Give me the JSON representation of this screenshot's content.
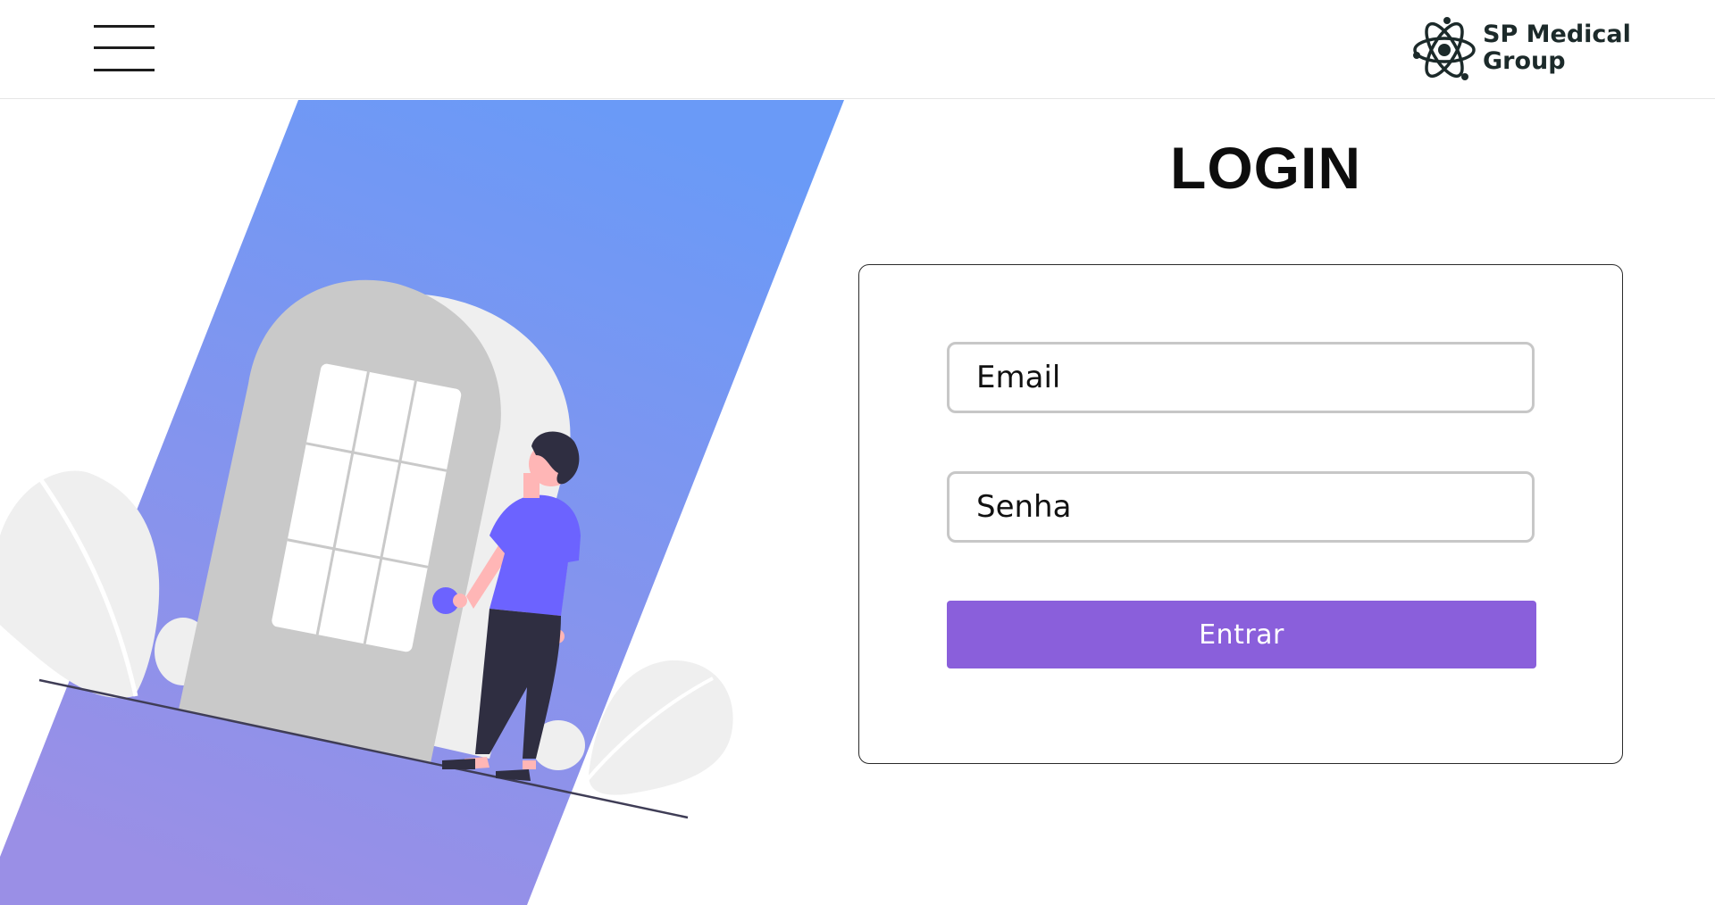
{
  "header": {
    "menu_icon": "hamburger-menu-icon",
    "logo": {
      "icon": "atom-icon",
      "line1": "SP Medical",
      "line2": "Group"
    }
  },
  "login": {
    "title": "LOGIN",
    "email_placeholder": "Email",
    "password_placeholder": "Senha",
    "submit_label": "Entrar"
  },
  "illustration": {
    "description_icon": "person-opening-door-illustration"
  },
  "colors": {
    "accent": "#8a5fdb",
    "banner_top": "#6a9af7",
    "banner_bottom": "#9a8fe6",
    "shirt": "#6c63ff"
  }
}
